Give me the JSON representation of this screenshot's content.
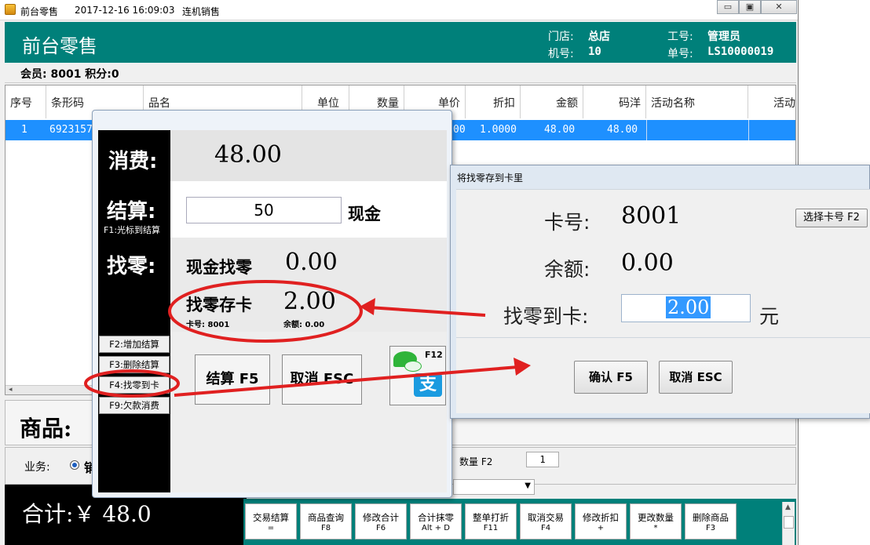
{
  "titlebar": {
    "app_name": "前台零售",
    "datetime": "2017-12-16 16:09:03",
    "mode": "连机销售",
    "btn_min": "▭",
    "btn_max": "▣",
    "btn_close": "✕"
  },
  "header": {
    "title": "前台零售",
    "store_label": "门店:",
    "store_value": "总店",
    "employee_label": "工号:",
    "employee_value": "管理员",
    "machine_label": "机号:",
    "machine_value": "10",
    "order_label": "单号:",
    "order_value": "LS10000019"
  },
  "member_bar": {
    "text": "会员: 8001 积分:0"
  },
  "grid": {
    "columns": [
      "序号",
      "条形码",
      "品名",
      "单位",
      "数量",
      "单价",
      "折扣",
      "金额",
      "码洋",
      "活动名称",
      "活动类"
    ],
    "rows": [
      {
        "seq": "1",
        "barcode": "6923157",
        "price": "00",
        "discount": "1.0000",
        "amount": "48.00",
        "list_price": "48.00"
      }
    ]
  },
  "goods_panel": {
    "label": "商品:"
  },
  "biz_bar": {
    "label": "业务:",
    "radio_label": "销",
    "qty_label": "数量 F2",
    "qty_value": "1"
  },
  "total_panel": {
    "text": "合计:￥ 48.0"
  },
  "function_buttons": [
    {
      "top": "交易结算",
      "bottom": "="
    },
    {
      "top": "商品查询",
      "bottom": "F8"
    },
    {
      "top": "修改合计",
      "bottom": "F6"
    },
    {
      "top": "合计抹零",
      "bottom": "Alt + D"
    },
    {
      "top": "整单打折",
      "bottom": "F11"
    },
    {
      "top": "取消交易",
      "bottom": "F4"
    },
    {
      "top": "修改折扣",
      "bottom": "+"
    },
    {
      "top": "更改数量",
      "bottom": "*"
    },
    {
      "top": "删除商品",
      "bottom": "F3"
    }
  ],
  "checkout": {
    "consume_label": "消费:",
    "consume_value": "48.00",
    "settle_label": "结算:",
    "settle_hint": "F1:光标到结算",
    "settle_input": "50",
    "settle_method": "现金",
    "change_label": "找零:",
    "cash_change_label": "现金找零",
    "cash_change_value": "0.00",
    "card_change_label": "找零存卡",
    "card_change_value": "2.00",
    "card_no_label": "卡号: 8001",
    "balance_label": "余额: 0.00",
    "side_buttons": [
      "F2:增加结算",
      "F3:删除结算",
      "F4:找零到卡",
      "F9:欠款消费"
    ],
    "settle_button": "结算 F5",
    "cancel_button": "取消 ESC",
    "pay_badge": "F12",
    "pay_alipay_char": "支"
  },
  "change_dialog": {
    "title": "将找零存到卡里",
    "card_label": "卡号:",
    "card_value": "8001",
    "select_card_button": "选择卡号 F2",
    "balance_label": "余额:",
    "balance_value": "0.00",
    "to_card_label": "找零到卡:",
    "to_card_input": "2.00",
    "unit": "元",
    "confirm_button": "确认 F5",
    "cancel_button": "取消 ESC"
  },
  "colors": {
    "teal": "#00807a",
    "selection": "#1e90ff",
    "annotation": "#e02020"
  }
}
